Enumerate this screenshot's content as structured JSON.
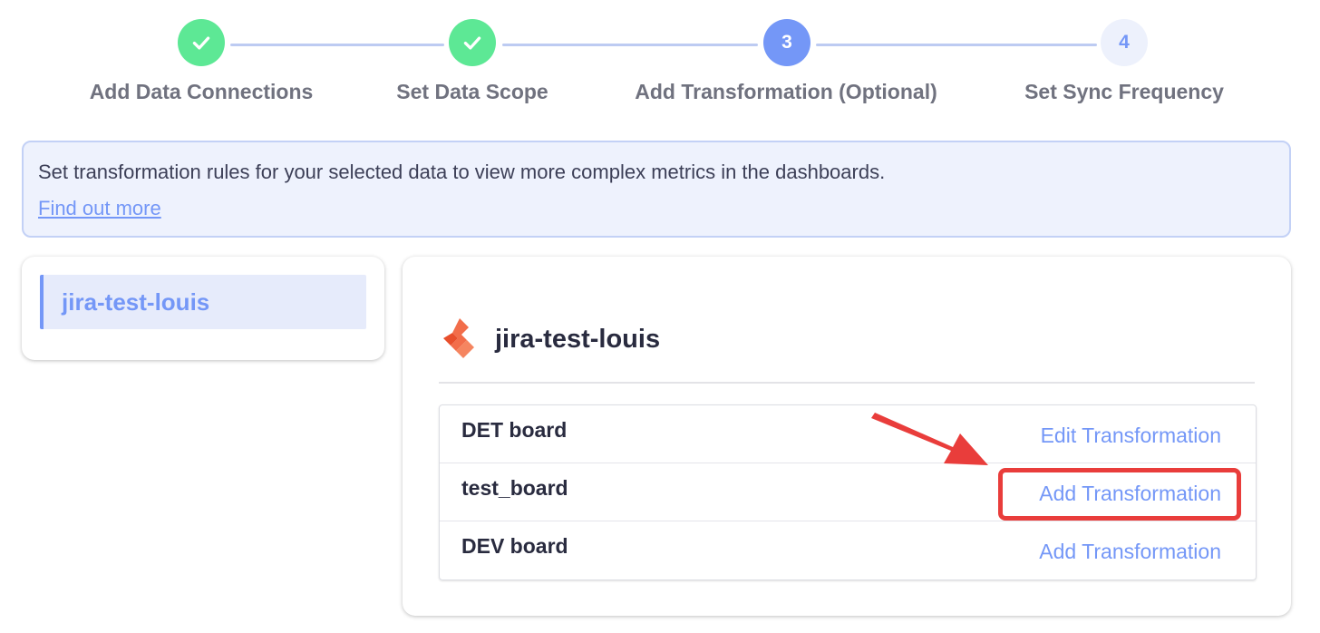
{
  "stepper": {
    "steps": [
      {
        "number": "1",
        "label": "Add Data Connections",
        "state": "done"
      },
      {
        "number": "2",
        "label": "Set Data Scope",
        "state": "done"
      },
      {
        "number": "3",
        "label": "Add Transformation (Optional)",
        "state": "active"
      },
      {
        "number": "4",
        "label": "Set Sync Frequency",
        "state": "todo"
      }
    ]
  },
  "banner": {
    "text": "Set transformation rules for your selected data to view more complex metrics in the dashboards.",
    "link": "Find out more"
  },
  "sidebar": {
    "connections": [
      {
        "name": "jira-test-louis",
        "selected": true
      }
    ]
  },
  "connection": {
    "title": "jira-test-louis",
    "icon": "jira-icon",
    "boards": [
      {
        "name": "DET board",
        "action": "Edit Transformation"
      },
      {
        "name": "test_board",
        "action": "Add Transformation"
      },
      {
        "name": "DEV board",
        "action": "Add Transformation"
      }
    ]
  },
  "colors": {
    "accent": "#7497f7",
    "done": "#5de895",
    "annotation": "#e93d3b"
  }
}
